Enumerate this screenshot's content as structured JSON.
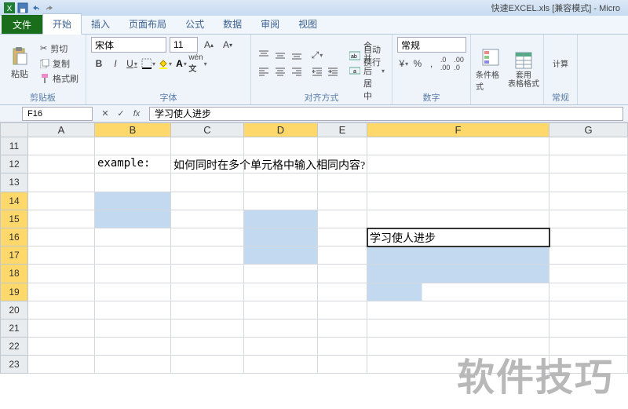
{
  "title": "快速EXCEL.xls  [兼容模式] - Micro",
  "tabs": {
    "file": "文件",
    "home": "开始",
    "insert": "插入",
    "layout": "页面布局",
    "formulas": "公式",
    "data": "数据",
    "review": "审阅",
    "view": "视图"
  },
  "clipboard": {
    "paste": "粘贴",
    "cut": "剪切",
    "copy": "复制",
    "format": "格式刷",
    "label": "剪贴板"
  },
  "font": {
    "name": "宋体",
    "size": "11",
    "label": "字体"
  },
  "align": {
    "wrap": "自动换行",
    "merge": "合并后居中",
    "label": "对齐方式"
  },
  "number": {
    "format": "常规",
    "label": "数字"
  },
  "styles": {
    "cond": "条件格式",
    "table": "套用\n表格格式",
    "calc": "计算",
    "label": "常规"
  },
  "namebox": "F16",
  "formula": "学习使人进步",
  "cols": {
    "A": 85,
    "B": 97,
    "C": 93,
    "D": 94,
    "E": 63,
    "F": 232,
    "G": 100
  },
  "rows": [
    "11",
    "12",
    "13",
    "14",
    "15",
    "16",
    "17",
    "18",
    "19",
    "20",
    "21",
    "22",
    "23"
  ],
  "cellB12": "example:",
  "cellC12": "如何同时在多个单元格中输入相同内容?",
  "cellF16": "学习使人进步",
  "watermark": "软件技巧"
}
